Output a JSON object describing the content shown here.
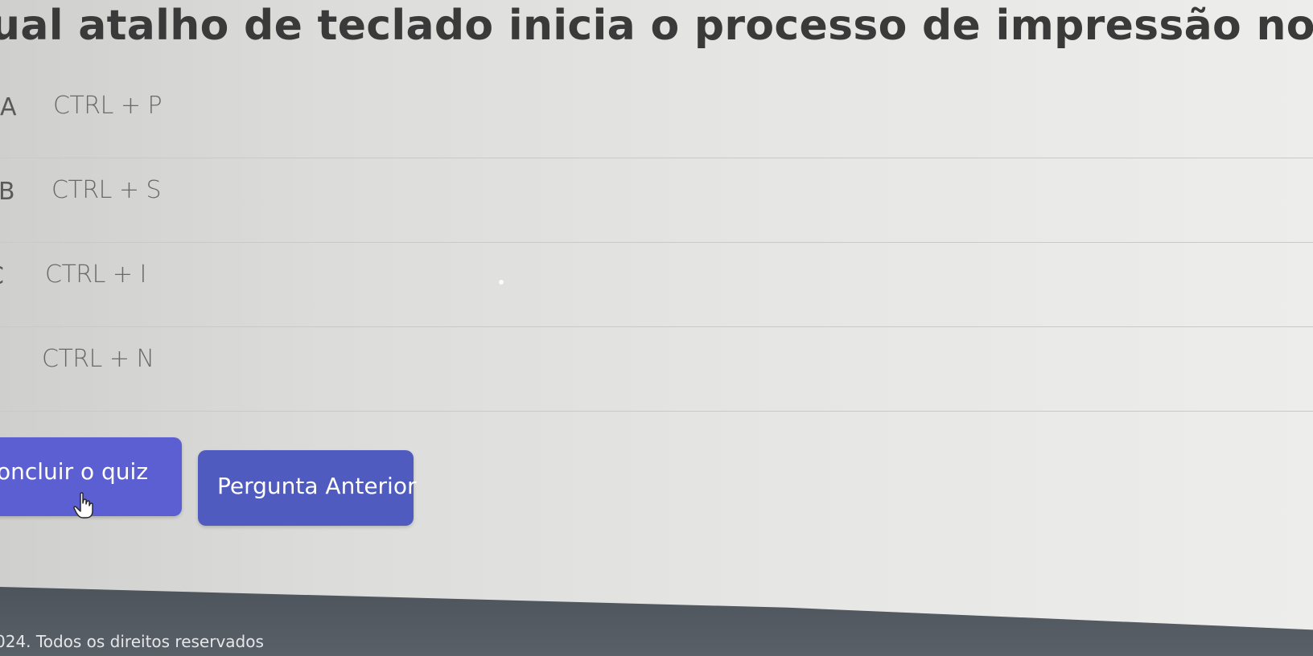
{
  "question": {
    "title": "ual atalho de teclado inicia o processo de impressão no Powe"
  },
  "options": [
    {
      "letter": "A",
      "text": "CTRL + P"
    },
    {
      "letter": "B",
      "text": "CTRL + S"
    },
    {
      "letter": "C",
      "text": "CTRL + I"
    },
    {
      "letter": ")",
      "text": "CTRL + N"
    }
  ],
  "buttons": {
    "conclude_label": "oncluir o quiz",
    "previous_label": "Pergunta Anterior"
  },
  "footer": {
    "copyright": "024. Todos os direitos reservados"
  },
  "colors": {
    "button_primary": "#5b5fd1",
    "button_secondary": "#4f5bbf",
    "footer_bg": "#4e545c"
  },
  "icons": {
    "cursor": "hand-pointer-icon"
  }
}
